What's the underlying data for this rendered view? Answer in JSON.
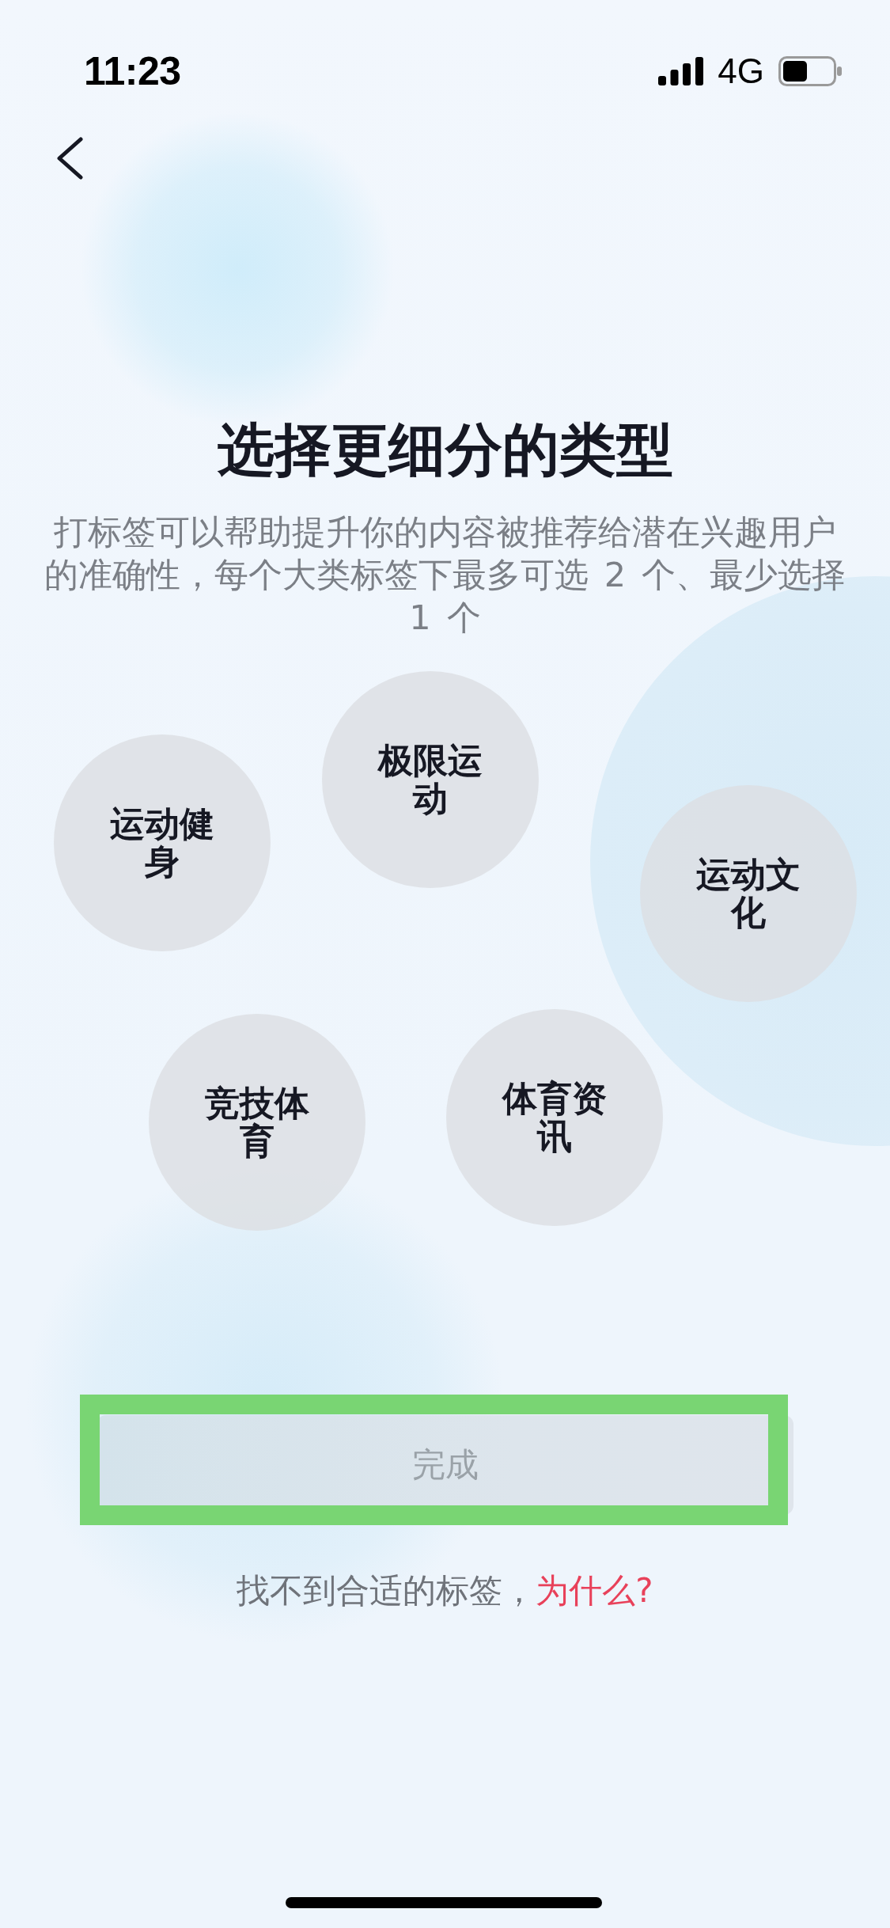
{
  "status_bar": {
    "time": "11:23",
    "network": "4G"
  },
  "header": {
    "title": "选择更细分的类型",
    "description": "打标签可以帮助提升你的内容被推荐给潜在兴趣用户的准确性，每个大类标签下最多可选 2 个、最少选择 1 个"
  },
  "tags": [
    {
      "label": "运动健身",
      "selected": false
    },
    {
      "label": "极限运动",
      "selected": false
    },
    {
      "label": "运动文化",
      "selected": false
    },
    {
      "label": "竞技体育",
      "selected": false
    },
    {
      "label": "体育资讯",
      "selected": false
    }
  ],
  "done_button": {
    "label": "完成",
    "disabled": true,
    "highlighted": true
  },
  "help": {
    "text": "找不到合适的标签，",
    "link": "为什么?"
  }
}
